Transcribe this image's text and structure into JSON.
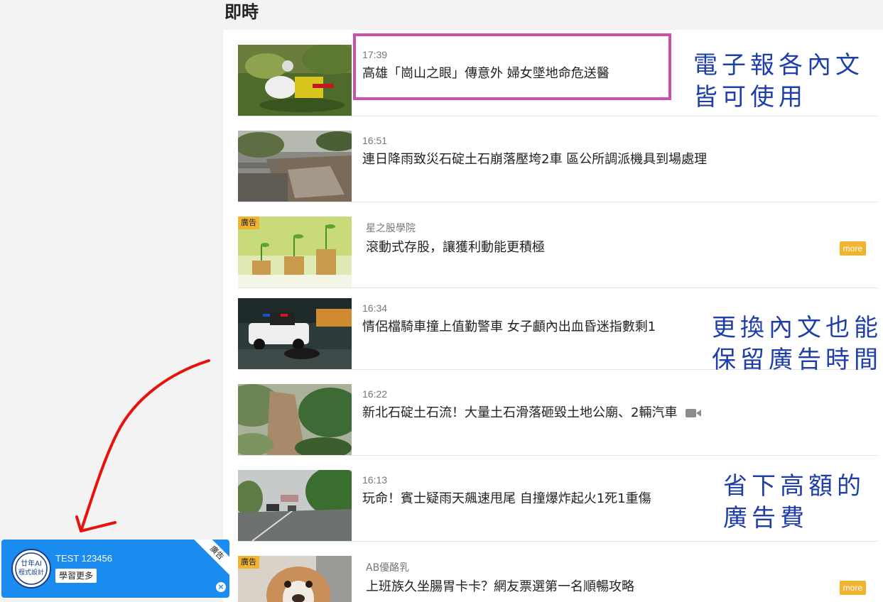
{
  "section_title": "即時",
  "feed": [
    {
      "type": "news",
      "time": "17:39",
      "headline": "高雄「崗山之眼」傳意外 婦女墜地命危送醫",
      "thumb": "rescue-scene-image"
    },
    {
      "type": "news",
      "time": "16:51",
      "headline": "連日降雨致災石碇土石崩落壓垮2車 區公所調派機具到場處理",
      "thumb": "landslide-road-image"
    },
    {
      "type": "ad",
      "tag": "廣告",
      "source": "星之股學院",
      "title": "滾動式存股，讓獲利動能更積極",
      "more": "more",
      "thumb": "coin-plants-image"
    },
    {
      "type": "news",
      "time": "16:34",
      "headline": "情侶檔騎車撞上值勤警車 女子顱內出血昏迷指數剩1",
      "thumb": "police-car-crash-image"
    },
    {
      "type": "news",
      "time": "16:22",
      "headline": "新北石碇土石流！大量土石滑落砸毀土地公廟、2輛汽車",
      "thumb": "mudslide-hill-image",
      "has_video": true
    },
    {
      "type": "news",
      "time": "16:13",
      "headline": "玩命！賓士疑雨天飆速甩尾 自撞爆炸起火1死1重傷",
      "thumb": "rainy-highway-image"
    },
    {
      "type": "ad",
      "tag": "廣告",
      "source": "AB優酪乳",
      "title": "上班族久坐腸胃卡卡？網友票選第一名順暢攻略",
      "more": "more",
      "thumb": "bulldog-image"
    }
  ],
  "annotations": {
    "note1": [
      "電子報各內文",
      "皆可使用"
    ],
    "note2": [
      "更換內文也能",
      "保留廣告時間"
    ],
    "note3": [
      "省下高額的",
      "廣告費"
    ],
    "highlight_color": "#cc4fa8",
    "arrow_color": "#e8120c",
    "note_color": "#1f3fa8"
  },
  "widget": {
    "title": "TEST 123456",
    "button": "學習更多",
    "ribbon": "廣告",
    "close_icon": "close-circle-icon",
    "logo_text": [
      "廿年AI",
      "程式設計"
    ],
    "bg_color": "#1a8cf0"
  },
  "colors": {
    "ad_badge": "#f0b431",
    "more_button": "#f0b431"
  }
}
